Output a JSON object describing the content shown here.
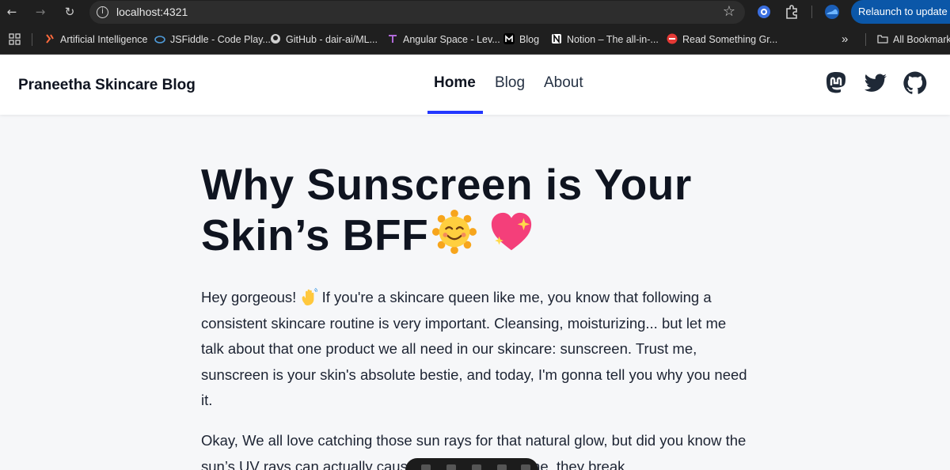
{
  "browser": {
    "url": "localhost:4321",
    "relaunch_label": "Relaunch to update",
    "bookmarks": [
      {
        "label": "Artificial Intelligence",
        "icon": "ai-icon",
        "color": "#ff6a3d"
      },
      {
        "label": "JSFiddle - Code Play...",
        "icon": "jsfiddle-icon",
        "color": "#4f9bd9"
      },
      {
        "label": "GitHub - dair-ai/ML...",
        "icon": "github-icon",
        "color": "#d0d0d0"
      },
      {
        "label": "Angular Space - Lev...",
        "icon": "angular-icon",
        "color": "#b06ad8"
      },
      {
        "label": "Blog",
        "icon": "m-icon",
        "color": "#ffffff"
      },
      {
        "label": "Notion – The all-in-...",
        "icon": "notion-icon",
        "color": "#ffffff"
      },
      {
        "label": "Read Something Gr...",
        "icon": "record-icon",
        "color": "#e53935"
      }
    ],
    "all_bookmarks_label": "All Bookmarks",
    "more_label": "»"
  },
  "header": {
    "brand": "Praneetha Skincare Blog",
    "nav": [
      {
        "label": "Home",
        "active": true
      },
      {
        "label": "Blog",
        "active": false
      },
      {
        "label": "About",
        "active": false
      }
    ],
    "social_icons": [
      "mastodon-icon",
      "twitter-icon",
      "github-icon"
    ],
    "accent_color": "#2337ff"
  },
  "article": {
    "title_line1": "Why Sunscreen is Your",
    "title_line2": "Skin’s BFF",
    "para1_before": "Hey gorgeous!",
    "para1_after": " If you're a skincare queen like me, you know that following a consistent skincare routine is very important. Cleansing, moisturizing... but let me talk about that one product we all need in our skincare: sunscreen. Trust me, sunscreen is your skin's absolute bestie, and today, I'm gonna tell you why you need it.",
    "para2": "Okay, We all love catching those sun rays for that natural glow, but did you know the sun’s UV rays can actually cause damage? Over time, they break"
  }
}
